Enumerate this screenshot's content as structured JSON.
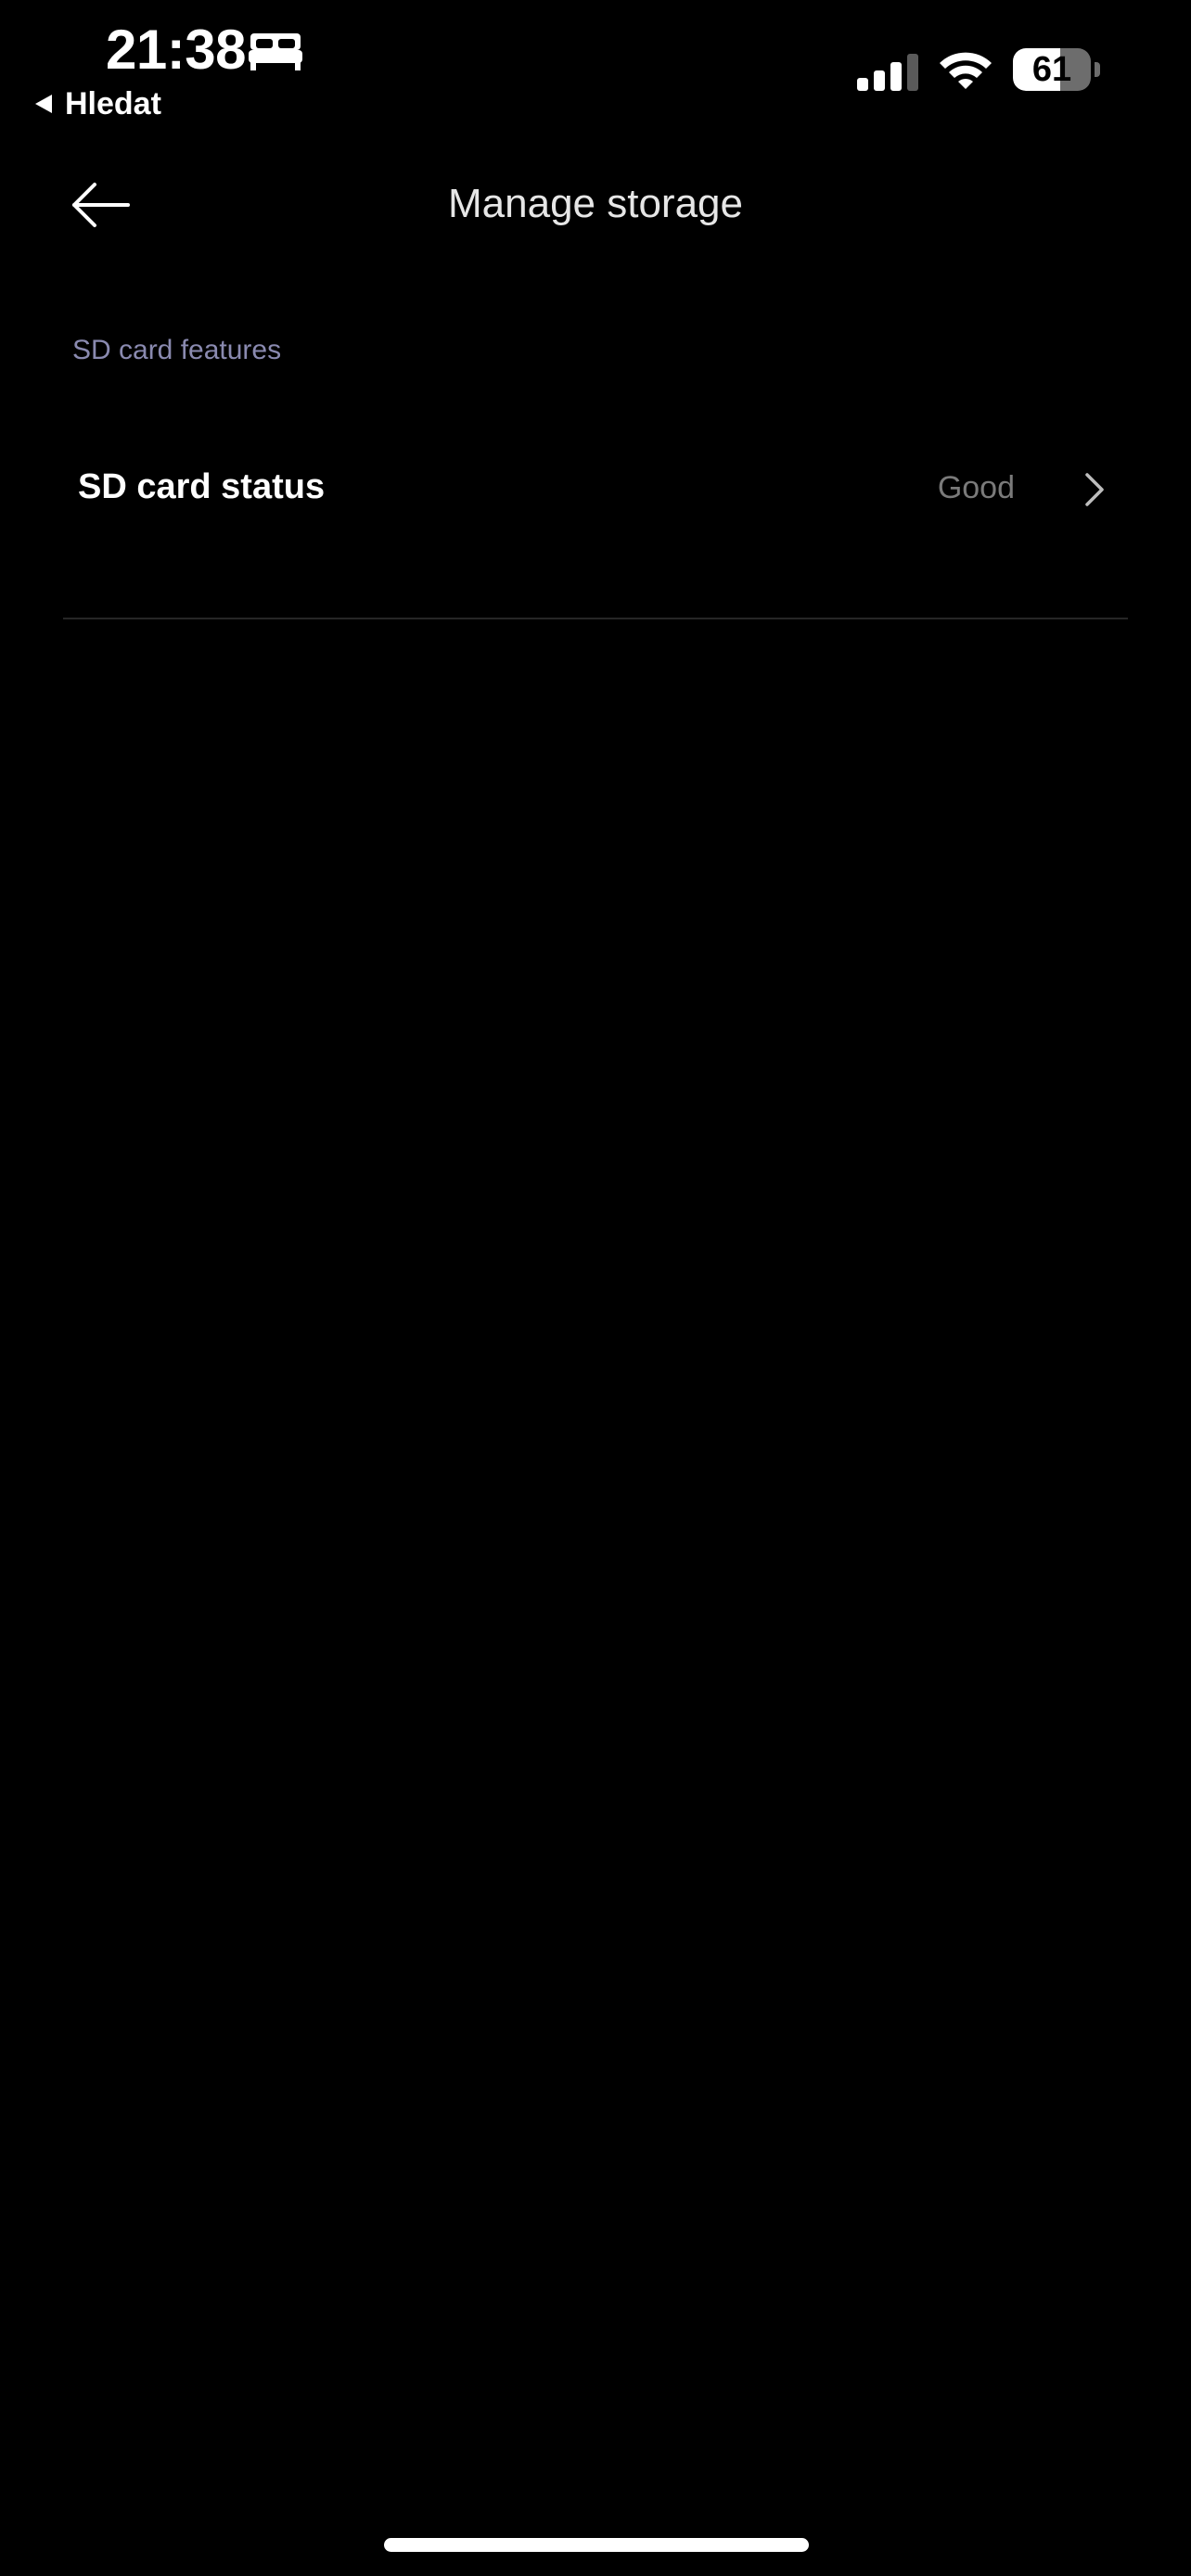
{
  "status_bar": {
    "time": "21:38",
    "back_app_label": "Hledat",
    "battery_percent": "61",
    "battery_level": 0.61,
    "icons": [
      "bed-icon",
      "signal-icon",
      "wifi-icon",
      "battery-icon"
    ]
  },
  "header": {
    "title": "Manage storage",
    "back_icon": "arrow-left-icon"
  },
  "section": {
    "label": "SD card features",
    "rows": [
      {
        "title": "SD card status",
        "value": "Good",
        "icon": "chevron-right-icon"
      }
    ]
  },
  "colors": {
    "background": "#000000",
    "section_label": "#8a8ab0",
    "value_text": "#7a7a7a",
    "divider": "#262626"
  }
}
